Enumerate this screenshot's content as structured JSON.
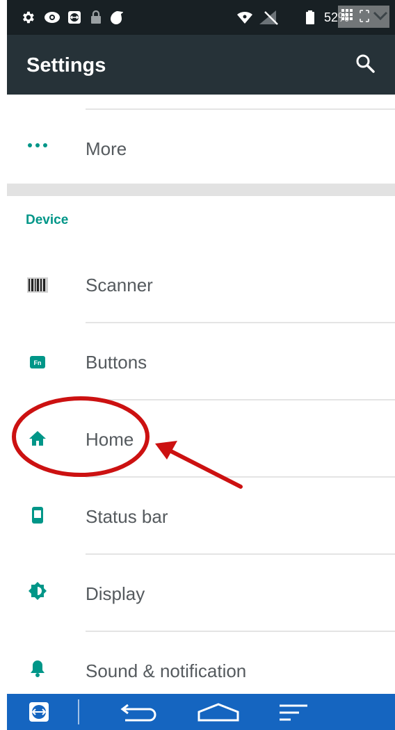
{
  "status_bar": {
    "battery_text": "52%",
    "icons": [
      "gear-icon",
      "eye-icon",
      "teamviewer-icon",
      "lock-icon",
      "drop-icon",
      "wifi-icon",
      "no-signal-icon",
      "battery-icon",
      "keyboard-icon",
      "expand-icon",
      "chevron-down-icon"
    ]
  },
  "app_bar": {
    "title": "Settings",
    "search_icon": "search-icon"
  },
  "list": {
    "more_label": "More",
    "section_header": "Device",
    "items": [
      {
        "label": "Scanner",
        "icon": "barcode-icon"
      },
      {
        "label": "Buttons",
        "icon": "fn-key-icon",
        "icon_text": "Fn"
      },
      {
        "label": "Home",
        "icon": "home-icon"
      },
      {
        "label": "Status bar",
        "icon": "phone-icon"
      },
      {
        "label": "Display",
        "icon": "brightness-icon"
      },
      {
        "label": "Sound & notification",
        "icon": "bell-icon"
      }
    ]
  },
  "nav_bar": {
    "icons": [
      "teamviewer-icon",
      "back-icon",
      "home-icon",
      "menu-icon"
    ]
  },
  "colors": {
    "status_bar": "#182024",
    "app_bar": "#263238",
    "accent": "#009688",
    "nav_bar": "#1565c0",
    "annotation": "#cc1111"
  }
}
